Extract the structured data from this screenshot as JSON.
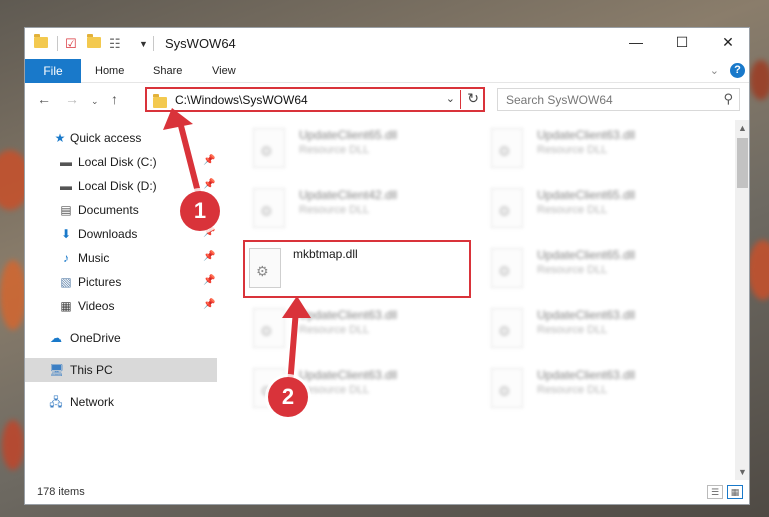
{
  "window": {
    "title": "SysWOW64",
    "controls": {
      "minimize": "—",
      "maximize": "☐",
      "close": "✕"
    }
  },
  "ribbon": {
    "tabs": [
      "File",
      "Home",
      "Share",
      "View"
    ]
  },
  "navigation": {
    "address": "C:\\Windows\\SysWOW64",
    "search_placeholder": "Search SysWOW64"
  },
  "sidebar": {
    "items": [
      {
        "label": "Quick access",
        "icon": "star-icon",
        "pinned": false
      },
      {
        "label": "Local Disk (C:)",
        "icon": "drive-icon",
        "pinned": true
      },
      {
        "label": "Local Disk (D:)",
        "icon": "drive-icon",
        "pinned": true
      },
      {
        "label": "Documents",
        "icon": "document-icon",
        "pinned": true
      },
      {
        "label": "Downloads",
        "icon": "download-icon",
        "pinned": true
      },
      {
        "label": "Music",
        "icon": "music-icon",
        "pinned": true
      },
      {
        "label": "Pictures",
        "icon": "picture-icon",
        "pinned": true
      },
      {
        "label": "Videos",
        "icon": "video-icon",
        "pinned": true
      },
      {
        "label": "OneDrive",
        "icon": "cloud-icon",
        "pinned": false
      },
      {
        "label": "This PC",
        "icon": "computer-icon",
        "pinned": false,
        "selected": true
      },
      {
        "label": "Network",
        "icon": "network-icon",
        "pinned": false
      }
    ]
  },
  "files": [
    {
      "name": "UpdateClient65.dll",
      "type": "Resource DLL",
      "blurred": true
    },
    {
      "name": "UpdateClient63.dll",
      "type": "Resource DLL",
      "blurred": true
    },
    {
      "name": "UpdateClient42.dll",
      "type": "Resource DLL",
      "blurred": true
    },
    {
      "name": "UpdateClient65.dll",
      "type": "Resource DLL",
      "blurred": true
    },
    {
      "name": "mkbtmap.dll",
      "type": "",
      "blurred": false,
      "highlighted": true
    },
    {
      "name": "UpdateClient65.dll",
      "type": "Resource DLL",
      "blurred": true
    },
    {
      "name": "UpdateClient63.dll",
      "type": "Resource DLL",
      "blurred": true
    },
    {
      "name": "UpdateClient63.dll",
      "type": "Resource DLL",
      "blurred": true
    },
    {
      "name": "UpdateClient63.dll",
      "type": "Resource DLL",
      "blurred": true
    },
    {
      "name": "UpdateClient63.dll",
      "type": "Resource DLL",
      "blurred": true
    }
  ],
  "status": {
    "item_count": "178 items"
  },
  "annotations": {
    "badge_1": "1",
    "badge_2": "2",
    "accent_color": "#d9333a"
  },
  "colors": {
    "file_tab": "#1979ca",
    "selected_nav": "#d9d9d9",
    "highlight": "#d9333a"
  }
}
